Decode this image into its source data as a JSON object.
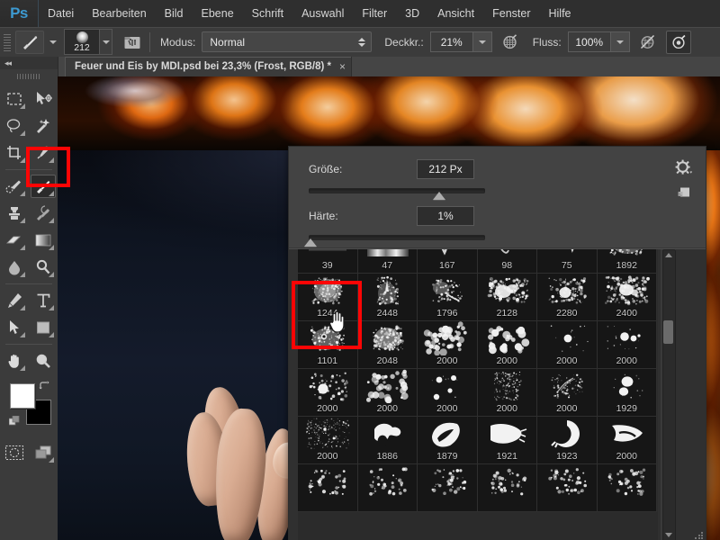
{
  "app": {
    "name": "Adobe Photoshop",
    "logo_text": "Ps",
    "accent_color": "#3d9ad1",
    "highlight_color": "#fc0505"
  },
  "menubar": {
    "items": [
      {
        "label": "Datei"
      },
      {
        "label": "Bearbeiten"
      },
      {
        "label": "Bild"
      },
      {
        "label": "Ebene"
      },
      {
        "label": "Schrift"
      },
      {
        "label": "Auswahl"
      },
      {
        "label": "Filter"
      },
      {
        "label": "3D"
      },
      {
        "label": "Ansicht"
      },
      {
        "label": "Fenster"
      },
      {
        "label": "Hilfe"
      }
    ]
  },
  "options_bar": {
    "tool_icon": "brush-icon",
    "brush_size_value": "212",
    "tablet_pressure_icon": "airbrush-panel-icon",
    "mode_label": "Modus:",
    "mode_value": "Normal",
    "opacity_label": "Deckkr.:",
    "opacity_value": "21%",
    "flow_label": "Fluss:",
    "flow_value": "100%",
    "airbrush_icon": "airbrush-icon",
    "pressure_opacity_icon": "pressure-opacity-icon",
    "pressure_size_icon": "pressure-size-icon"
  },
  "document_tab": {
    "title": "Feuer und Eis by MDI.psd bei 23,3% (Frost, RGB/8) *",
    "close_label": "×"
  },
  "toolbar": {
    "collapse_label": "◂◂",
    "tools": [
      {
        "name": "rectangular-marquee-tool",
        "row": 0,
        "col": 0
      },
      {
        "name": "move-tool",
        "row": 0,
        "col": 1
      },
      {
        "name": "lasso-tool",
        "row": 1,
        "col": 0
      },
      {
        "name": "magic-wand-tool",
        "row": 1,
        "col": 1
      },
      {
        "name": "crop-tool",
        "row": 2,
        "col": 0
      },
      {
        "name": "eyedropper-tool",
        "row": 2,
        "col": 1
      },
      {
        "name": "spot-healing-brush-tool",
        "row": 3,
        "col": 0
      },
      {
        "name": "brush-tool",
        "row": 3,
        "col": 1,
        "active": true
      },
      {
        "name": "clone-stamp-tool",
        "row": 4,
        "col": 0
      },
      {
        "name": "history-brush-tool",
        "row": 4,
        "col": 1
      },
      {
        "name": "eraser-tool",
        "row": 5,
        "col": 0
      },
      {
        "name": "gradient-tool",
        "row": 5,
        "col": 1
      },
      {
        "name": "blur-tool",
        "row": 6,
        "col": 0
      },
      {
        "name": "dodge-tool",
        "row": 6,
        "col": 1
      },
      {
        "name": "pen-tool",
        "row": 7,
        "col": 0
      },
      {
        "name": "type-tool",
        "row": 7,
        "col": 1
      },
      {
        "name": "path-selection-tool",
        "row": 8,
        "col": 0
      },
      {
        "name": "rectangle-tool",
        "row": 8,
        "col": 1
      },
      {
        "name": "hand-tool",
        "row": 9,
        "col": 0
      },
      {
        "name": "zoom-tool",
        "row": 9,
        "col": 1
      },
      {
        "name": "quick-mask-tool",
        "row": 10,
        "col": 0
      },
      {
        "name": "screen-mode-tool",
        "row": 10,
        "col": 1
      }
    ],
    "foreground_color": "#ffffff",
    "background_color": "#000000"
  },
  "brush_panel": {
    "size_label": "Größe:",
    "size_value": "212 Px",
    "size_slider_percent": 74,
    "hardness_label": "Härte:",
    "hardness_value": "1%",
    "hardness_slider_percent": 1,
    "gear_icon": "gear-icon",
    "new_preset_icon": "new-brush-preset-icon",
    "scrollbar_position_percent": 24,
    "presets": [
      {
        "num": "39",
        "style": "soft-bar",
        "hidden_label": true
      },
      {
        "num": "47",
        "style": "streak-bar"
      },
      {
        "num": "167",
        "style": "thin-v"
      },
      {
        "num": "98",
        "style": "thin-squiggle"
      },
      {
        "num": "75",
        "style": "zigzag"
      },
      {
        "num": "1892",
        "style": "soft-spatter"
      },
      {
        "num": "1244",
        "style": "soft-round-grain",
        "selected": true
      },
      {
        "num": "2448",
        "style": "vertical-grain"
      },
      {
        "num": "1796",
        "style": "comet"
      },
      {
        "num": "2128",
        "style": "cloud-spatter"
      },
      {
        "num": "2280",
        "style": "blob-spatter"
      },
      {
        "num": "2400",
        "style": "wide-spatter"
      },
      {
        "num": "1101",
        "style": "ring-grain"
      },
      {
        "num": "2048",
        "style": "dense-grain"
      },
      {
        "num": "2000",
        "style": "bubbles-dense"
      },
      {
        "num": "2000",
        "style": "bubbles-mid"
      },
      {
        "num": "2000",
        "style": "single-dot"
      },
      {
        "num": "2000",
        "style": "three-dots"
      },
      {
        "num": "2000",
        "style": "splat-star"
      },
      {
        "num": "2000",
        "style": "scatter-dots"
      },
      {
        "num": "2000",
        "style": "sparse-dots"
      },
      {
        "num": "2000",
        "style": "faint-mist"
      },
      {
        "num": "2000",
        "style": "scratch"
      },
      {
        "num": "1929",
        "style": "two-blobs"
      },
      {
        "num": "2000",
        "style": "star-field"
      },
      {
        "num": "1886",
        "style": "grunge-ring"
      },
      {
        "num": "1879",
        "style": "torn-shape"
      },
      {
        "num": "1921",
        "style": "wide-stroke"
      },
      {
        "num": "1923",
        "style": "crescent"
      },
      {
        "num": "2000",
        "style": "slash-grunge"
      },
      {
        "num": "",
        "style": "partial-a"
      },
      {
        "num": "",
        "style": "partial-b"
      },
      {
        "num": "",
        "style": "partial-c"
      },
      {
        "num": "",
        "style": "partial-d"
      },
      {
        "num": "",
        "style": "partial-e"
      },
      {
        "num": "",
        "style": "partial-f"
      }
    ]
  },
  "canvas": {
    "description": "Photo of a person in dark navy shirt with hand raised, flames across top and right edge",
    "zoom_level": "23,3%"
  }
}
